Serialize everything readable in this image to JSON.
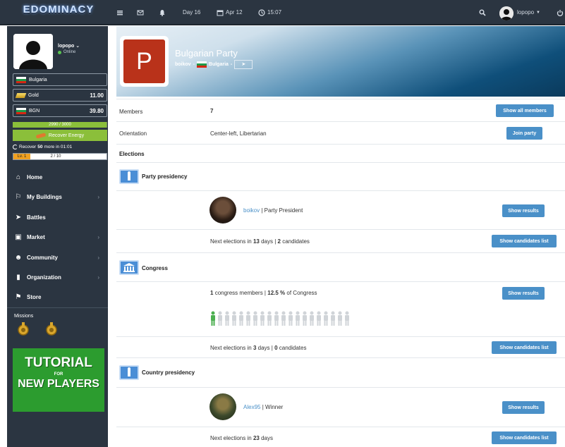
{
  "topbar": {
    "logo": "EDOMINACY",
    "day": "Day 16",
    "date": "Apr 12",
    "time": "15:07",
    "user": "lopopo"
  },
  "sidebar": {
    "username": "lopopo",
    "status": "Online",
    "country": "Bulgaria",
    "gold_label": "Gold",
    "gold_value": "11.00",
    "currency_label": "BGN",
    "currency_value": "39.80",
    "energy": "2990 / 3000",
    "energy_fraction": 0.997,
    "recover_btn": "Recover Energy",
    "recover_pre": "Recover",
    "recover_amount": "50",
    "recover_post": "more in 01:01",
    "level": "Lv. 1",
    "xp": "2 / 10",
    "menu": [
      {
        "label": "Home",
        "icon": "home-icon"
      },
      {
        "label": "My Buildings",
        "icon": "flag-icon"
      },
      {
        "label": "Battles",
        "icon": "plane-icon"
      },
      {
        "label": "Market",
        "icon": "cart-icon"
      },
      {
        "label": "Community",
        "icon": "users-icon"
      },
      {
        "label": "Organization",
        "icon": "book-icon"
      },
      {
        "label": "Store",
        "icon": "gift-icon"
      }
    ],
    "missions_label": "Missions",
    "tutorial_line1": "TUTORIAL",
    "tutorial_line2": "FOR",
    "tutorial_line3": "NEW PLAYERS"
  },
  "party": {
    "logo_letter": "P",
    "name": "Bulgarian Party",
    "leader": "boikov",
    "country": "Bulgaria",
    "members_label": "Members",
    "members_value": "7",
    "members_btn": "Show all members",
    "orientation_label": "Orientation",
    "orientation_value": "Center-left, Libertarian",
    "join_btn": "Join party",
    "elections_label": "Elections"
  },
  "party_presidency": {
    "title": "Party presidency",
    "name": "boikov",
    "role": "| Party President",
    "results_btn": "Show results",
    "next_pre": "Next elections in",
    "days": "13",
    "mid": "days |",
    "candidates": "2",
    "post": "candidates",
    "candidates_btn": "Show candidates list"
  },
  "congress": {
    "title": "Congress",
    "members": "1",
    "members_text": "congress members |",
    "percent": "12.5 %",
    "percent_text": "of Congress",
    "results_btn": "Show results",
    "seats_filled": 1,
    "seats_total": 20,
    "next_pre": "Next elections in",
    "days": "3",
    "mid": "days |",
    "candidates": "0",
    "post": "candidates",
    "candidates_btn": "Show candidates list"
  },
  "country_presidency": {
    "title": "Country presidency",
    "name": "Alex95",
    "role": "| Winner",
    "results_btn": "Show results",
    "next_pre": "Next elections in",
    "days": "23",
    "post": "days",
    "candidates_btn": "Show candidates list"
  }
}
